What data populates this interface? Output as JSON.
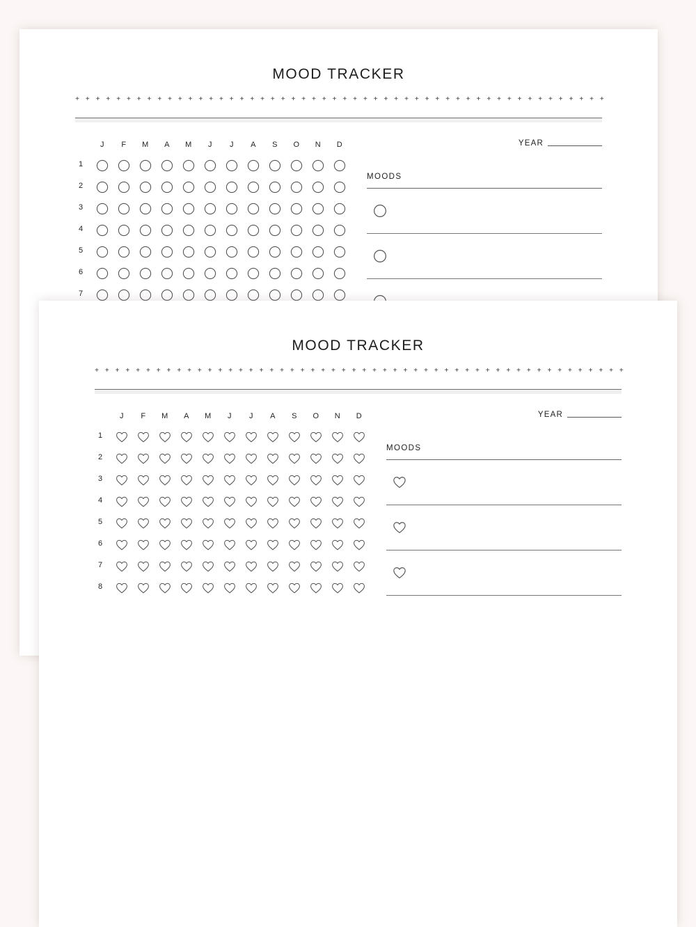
{
  "background_color": "#fcf7f6",
  "pages": [
    {
      "title": "MOOD TRACKER",
      "marker_icon": "circle-icon",
      "months": [
        "J",
        "F",
        "M",
        "A",
        "M",
        "J",
        "J",
        "A",
        "S",
        "O",
        "N",
        "D"
      ],
      "visible_days": [
        1,
        2,
        3,
        4,
        5,
        6,
        7
      ],
      "year_label": "YEAR",
      "year_value": "",
      "moods_label": "MOODS",
      "mood_entries": [
        {
          "icon": "circle-icon",
          "text": ""
        },
        {
          "icon": "circle-icon",
          "text": ""
        },
        {
          "icon": "circle-icon",
          "text": ""
        }
      ]
    },
    {
      "title": "MOOD TRACKER",
      "marker_icon": "heart-icon",
      "months": [
        "J",
        "F",
        "M",
        "A",
        "M",
        "J",
        "J",
        "A",
        "S",
        "O",
        "N",
        "D"
      ],
      "visible_days": [
        1,
        2,
        3,
        4,
        5,
        6,
        7,
        8
      ],
      "year_label": "YEAR",
      "year_value": "",
      "moods_label": "MOODS",
      "mood_entries": [
        {
          "icon": "heart-icon",
          "text": ""
        },
        {
          "icon": "heart-icon",
          "text": ""
        },
        {
          "icon": "heart-icon",
          "text": ""
        }
      ]
    }
  ],
  "decoration": {
    "plus_glyph": "+",
    "plus_count": 52
  }
}
